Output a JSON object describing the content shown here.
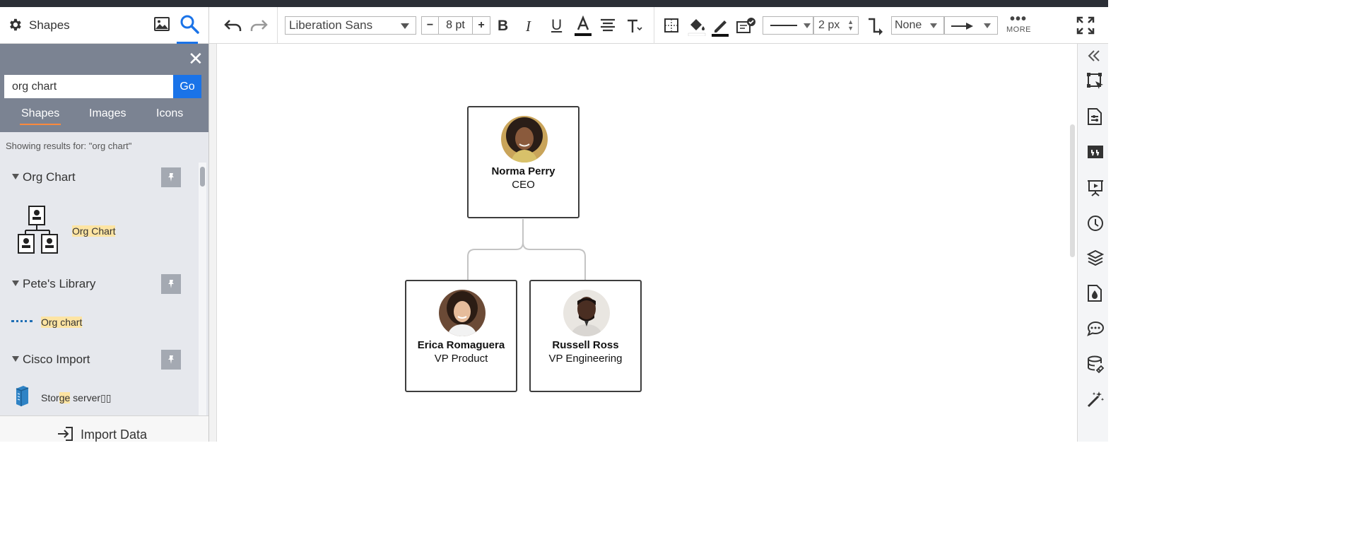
{
  "header": {
    "panel_title": "Shapes",
    "font_family": "Liberation Sans",
    "font_size": "8 pt",
    "size_minus": "−",
    "size_plus": "+",
    "line_width": "2 px",
    "endpoint": "None",
    "more_label": "MORE"
  },
  "search": {
    "value": "org chart",
    "go_label": "Go",
    "tabs": [
      "Shapes",
      "Images",
      "Icons"
    ],
    "active_tab": "Shapes",
    "showing_text": "Showing results for: \"org chart\""
  },
  "libraries": [
    {
      "name": "Org Chart",
      "item": "Org Chart",
      "item_icon": "org-chart-icon"
    },
    {
      "name": "Pete's Library",
      "item": "Org chart",
      "item_icon": "dotted-line-icon"
    },
    {
      "name": "Cisco Import",
      "item_prefix": "Stor",
      "item_highlight": "ge",
      "item_suffix": " server",
      "item_tail": "▯▯",
      "item_icon": "storage-server-icon"
    }
  ],
  "import_label": "Import Data",
  "org": {
    "ceo": {
      "name": "Norma Perry",
      "role": "CEO"
    },
    "vp1": {
      "name": "Erica Romaguera",
      "role": "VP Product"
    },
    "vp2": {
      "name": "Russell Ross",
      "role": "VP Engineering"
    }
  },
  "colors": {
    "accent": "#1a73e8",
    "search_panel": "#7b8392",
    "tab_underline": "#ff8a3d",
    "highlight": "#fde4a3"
  }
}
